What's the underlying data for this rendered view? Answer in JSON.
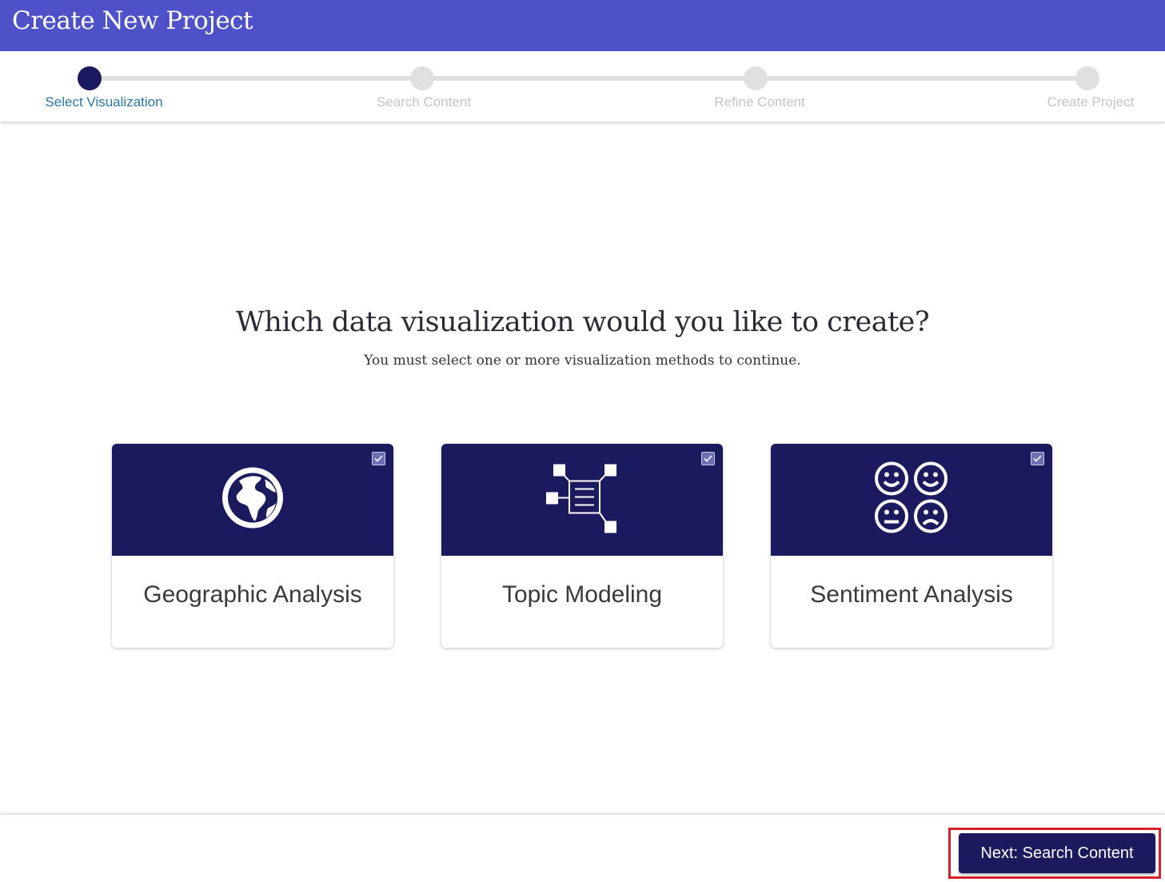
{
  "header": {
    "title": "Create New Project"
  },
  "stepper": {
    "steps": [
      {
        "label": "Select Visualization",
        "active": true
      },
      {
        "label": "Search Content",
        "active": false
      },
      {
        "label": "Refine Content",
        "active": false
      },
      {
        "label": "Create Project",
        "active": false
      }
    ]
  },
  "main": {
    "question": "Which data visualization would you like to create?",
    "instruction": "You must select one or more visualization methods to continue."
  },
  "cards": [
    {
      "label": "Geographic Analysis",
      "icon": "globe-icon",
      "checked": true
    },
    {
      "label": "Topic Modeling",
      "icon": "topic-network-icon",
      "checked": true
    },
    {
      "label": "Sentiment Analysis",
      "icon": "sentiment-faces-icon",
      "checked": true
    }
  ],
  "footer": {
    "next_label": "Next: Search Content"
  },
  "colors": {
    "header": "#4f51c8",
    "navy": "#1b1a5e",
    "active_step_text": "#2a78a8",
    "highlight": "#d8202a"
  }
}
